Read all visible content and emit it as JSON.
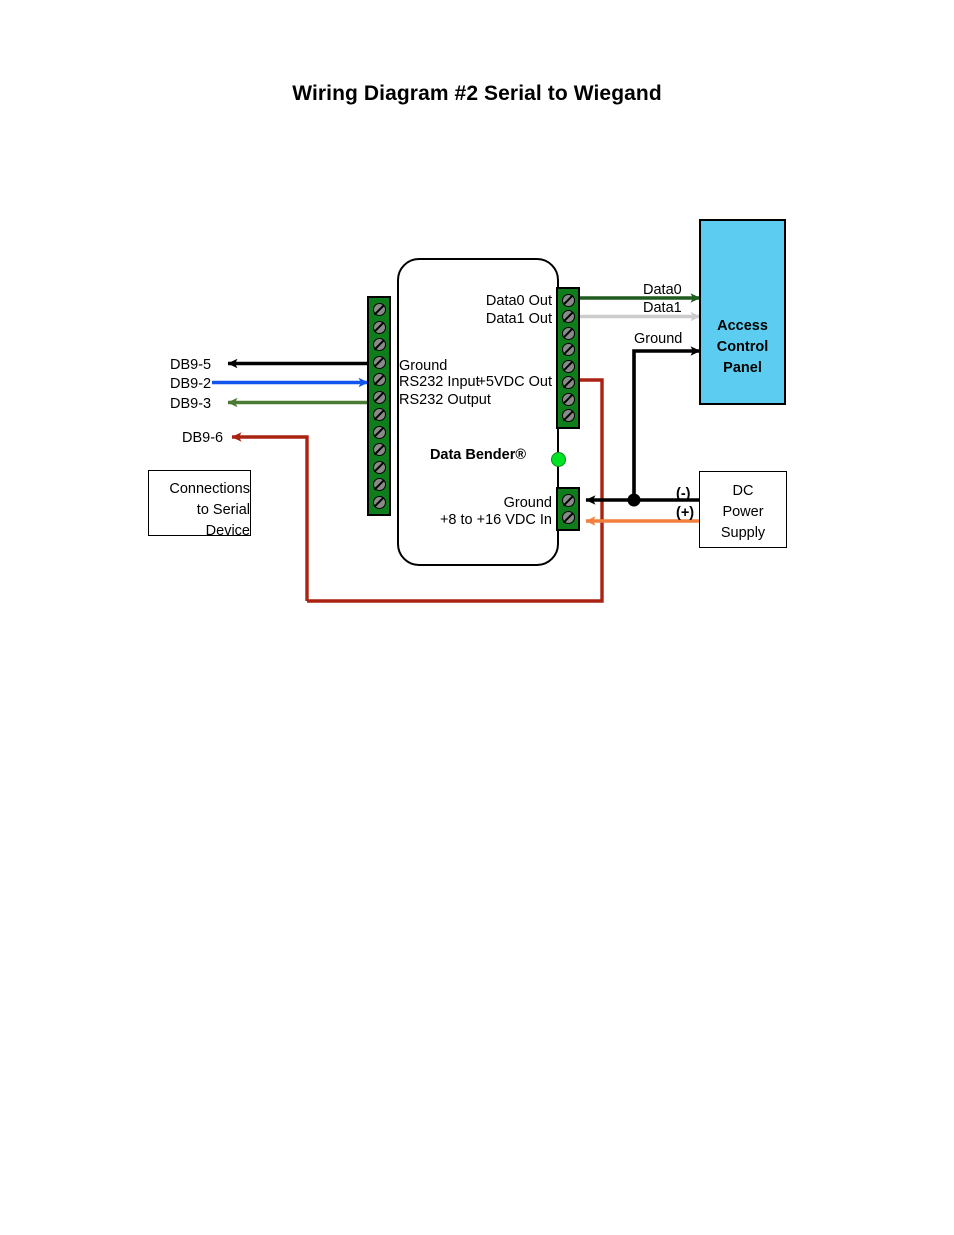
{
  "title": "Wiring Diagram #2  Serial to Wiegand",
  "device": {
    "name": "Data Bender®",
    "led": "green-status-led",
    "left_terminal_screw_count": 12,
    "right_terminal_screw_count": 8,
    "power_terminal_screw_count": 2,
    "left_labels": [
      "Ground",
      "RS232 Input",
      "RS232 Output"
    ],
    "right_labels": [
      "Data0 Out",
      "Data1 Out",
      "+5VDC Out"
    ],
    "power_labels": [
      "Ground",
      "+8 to +16 VDC In"
    ]
  },
  "serial_side": {
    "pins": [
      {
        "label": "DB9-5",
        "wire_color": "#000000",
        "direction": "to-db9"
      },
      {
        "label": "DB9-2",
        "wire_color": "#1155ee",
        "direction": "to-device"
      },
      {
        "label": "DB9-3",
        "wire_color": "#4a7a33",
        "direction": "to-db9"
      },
      {
        "label": "DB9-6",
        "wire_color": "#aa2211",
        "direction": "to-db9"
      }
    ],
    "box_lines": [
      "Connections",
      "to Serial",
      "Device"
    ]
  },
  "access_control_panel": {
    "lines": [
      "Access",
      "Control",
      "Panel"
    ],
    "fill_color": "#5ccdf0",
    "border_color": "#000000"
  },
  "power_supply": {
    "lines": [
      "DC",
      "Power",
      "Supply"
    ],
    "negative_label": "(-)",
    "positive_label": "(+)"
  },
  "wires": [
    {
      "name": "data0",
      "label": "Data0",
      "color": "#1f5c1f"
    },
    {
      "name": "data1",
      "label": "Data1",
      "color": "#cccccc"
    },
    {
      "name": "ground",
      "label": "Ground",
      "color": "#000000"
    },
    {
      "name": "vplus",
      "label": "",
      "color": "#f2803c"
    },
    {
      "name": "vdc-loop",
      "label": "",
      "color": "#aa2211"
    }
  ]
}
